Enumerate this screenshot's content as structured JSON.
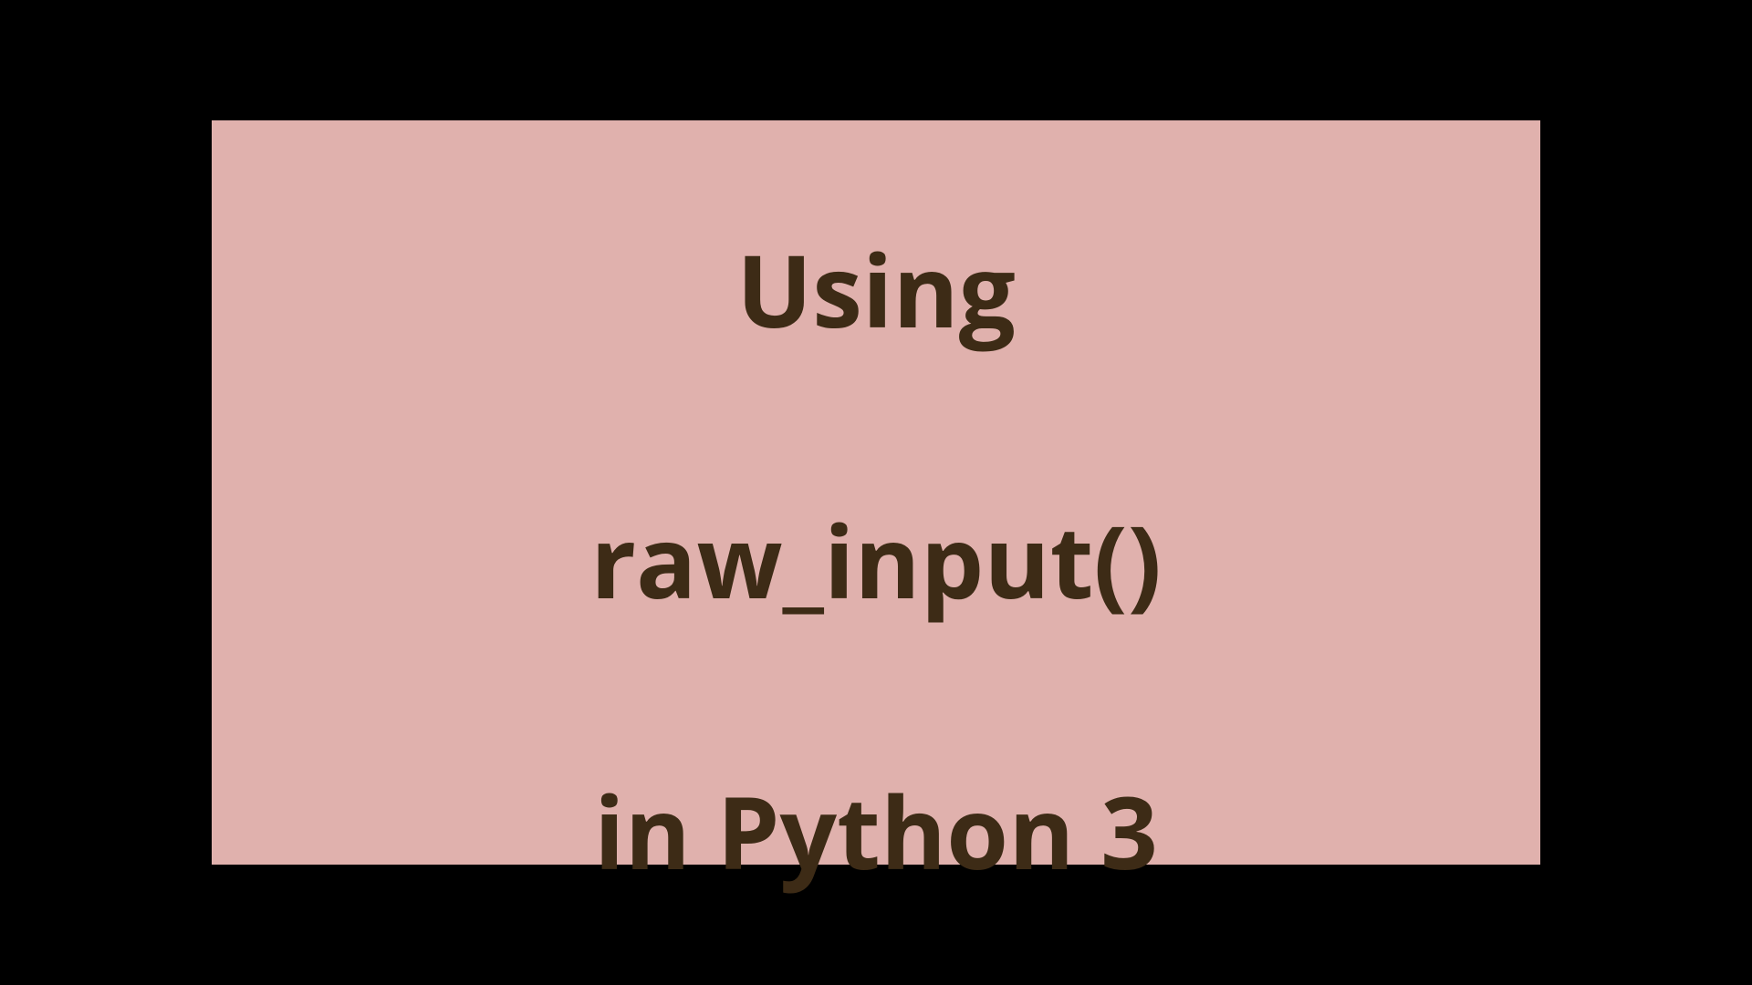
{
  "title": {
    "line1": "Using",
    "line2": "raw_input()",
    "line3": "in Python 3"
  },
  "colors": {
    "background": "#e0b1ad",
    "text": "#3d2b16"
  }
}
